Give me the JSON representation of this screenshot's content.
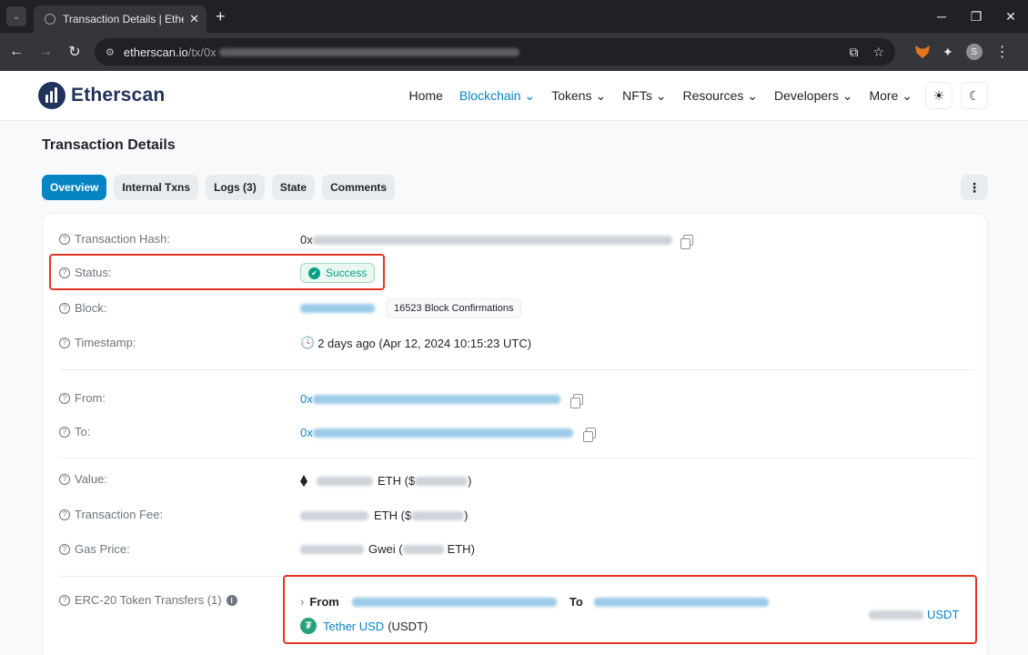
{
  "browser": {
    "tab_title": "Transaction Details | Etherscan",
    "url_host": "etherscan.io",
    "url_path": "/tx/0x",
    "avatar_initial": "S"
  },
  "header": {
    "logo_text": "Etherscan",
    "nav": [
      {
        "label": "Home",
        "has_dropdown": false
      },
      {
        "label": "Blockchain",
        "has_dropdown": true,
        "active": true
      },
      {
        "label": "Tokens",
        "has_dropdown": true
      },
      {
        "label": "NFTs",
        "has_dropdown": true
      },
      {
        "label": "Resources",
        "has_dropdown": true
      },
      {
        "label": "Developers",
        "has_dropdown": true
      },
      {
        "label": "More",
        "has_dropdown": true
      }
    ],
    "icons": [
      "sun-icon",
      "moon-icon"
    ]
  },
  "page": {
    "title": "Transaction Details",
    "tabs": [
      "Overview",
      "Internal Txns",
      "Logs (3)",
      "State",
      "Comments"
    ],
    "active_tab": "Overview"
  },
  "details": {
    "hash_label": "Transaction Hash:",
    "hash_prefix": "0x",
    "status_label": "Status:",
    "status_value": "Success",
    "block_label": "Block:",
    "block_confirmations": "16523 Block Confirmations",
    "timestamp_label": "Timestamp:",
    "timestamp_value": "2 days ago (Apr 12, 2024 10:15:23 UTC)",
    "from_label": "From:",
    "from_prefix": "0x",
    "to_label": "To:",
    "to_prefix": "0x",
    "value_label": "Value:",
    "value_unit": "ETH ($",
    "value_close": ")",
    "fee_label": "Transaction Fee:",
    "fee_unit": "ETH ($",
    "fee_close": ")",
    "gas_label": "Gas Price:",
    "gas_unit": "Gwei (",
    "gas_close": "ETH)",
    "erc20_label": "ERC-20 Token Transfers (1)",
    "erc20_from": "From",
    "erc20_to": "To",
    "token_name": "Tether USD",
    "token_symbol": "(USDT)",
    "amount_unit": "USDT"
  },
  "colors": {
    "accent": "#0784c3",
    "success": "#00a186",
    "highlight": "#e53323"
  }
}
